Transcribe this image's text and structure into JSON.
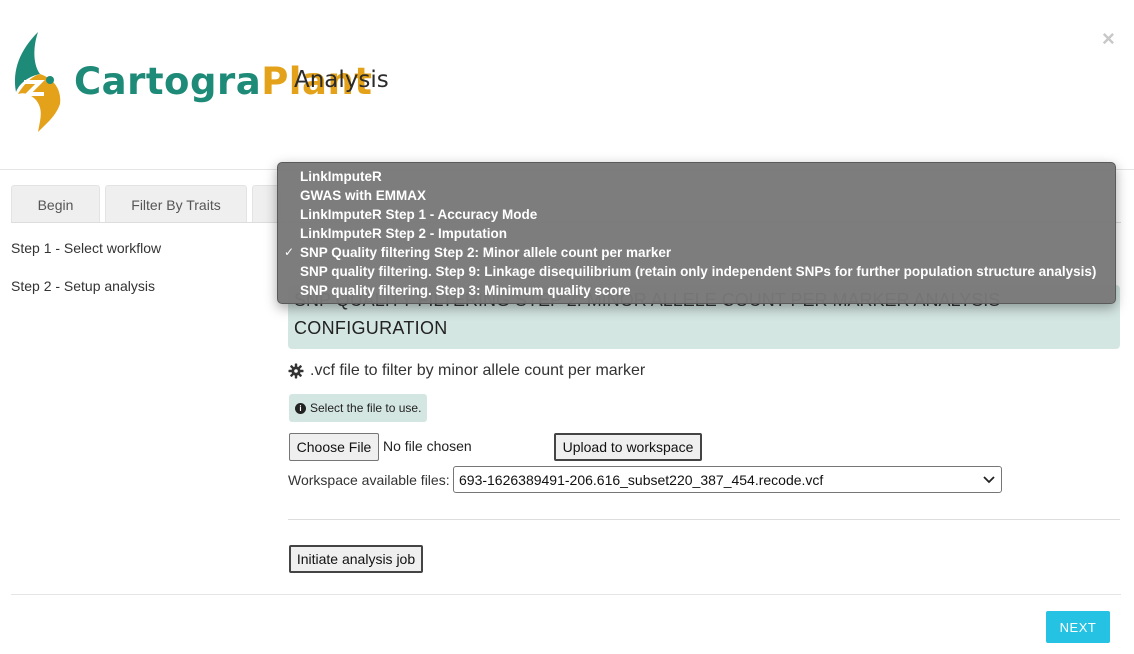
{
  "header": {
    "brand_part1": "Cartogra",
    "brand_part2": "Plant",
    "subtitle": "Analysis",
    "close_label": "×"
  },
  "tabs": [
    {
      "label": "Begin"
    },
    {
      "label": "Filter By Traits"
    }
  ],
  "steps": [
    {
      "label": "Step 1 - Select workflow"
    },
    {
      "label": "Step 2 - Setup analysis"
    }
  ],
  "config": {
    "hidden_title": "SNP QUALITY FILTERING STEP 2: MINOR ALLELE COUNT PER MARKER ANALYSIS",
    "title": "CONFIGURATION",
    "vcf_label": ".vcf file to filter by minor allele count per marker",
    "info_text": "Select the file to use.",
    "choose_file_label": "Choose File",
    "no_file_text": "No file chosen",
    "upload_label": "Upload to workspace",
    "workspace_label": "Workspace available files:",
    "workspace_selected": "693-1626389491-206.616_subset220_387_454.recode.vcf",
    "initiate_label": "Initiate analysis job",
    "next_label": "NEXT"
  },
  "dropdown": {
    "options": [
      {
        "label": "LinkImputeR",
        "selected": false
      },
      {
        "label": "GWAS with EMMAX",
        "selected": false
      },
      {
        "label": "LinkImputeR Step 1 - Accuracy Mode",
        "selected": false
      },
      {
        "label": "LinkImputeR Step 2 - Imputation",
        "selected": false
      },
      {
        "label": "SNP Quality filtering Step 2: Minor allele count per marker",
        "selected": true
      },
      {
        "label": "SNP quality filtering. Step 9: Linkage disequilibrium (retain only independent SNPs for further population structure analysis)",
        "selected": false
      },
      {
        "label": "SNP quality filtering. Step 3: Minimum quality score",
        "selected": false
      }
    ],
    "check_glyph": "✓"
  },
  "colors": {
    "brand_teal": "#1e8a78",
    "brand_orange": "#e3a21a",
    "config_bg": "#d4e6e2",
    "next_button": "#25c2e3"
  },
  "icons": {
    "logo": "cartograplant-leaf-logo",
    "close": "close-icon",
    "gear": "gear-icon",
    "info": "info-icon",
    "select_chevron": "chevron-down-icon",
    "check": "check-icon"
  }
}
